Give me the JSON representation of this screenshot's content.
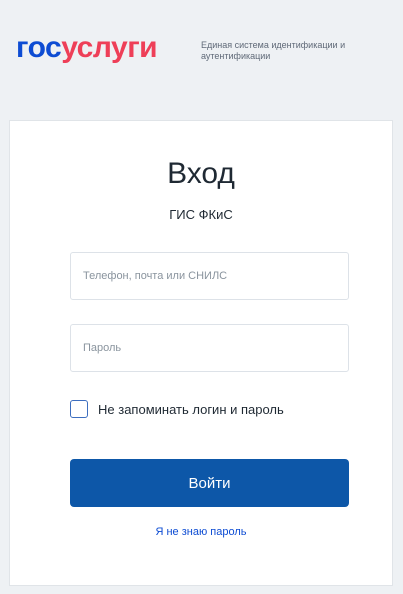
{
  "header": {
    "logo_part_a": "гос",
    "logo_part_b": "услуги",
    "tagline": "Единая система идентификации и аутентификации"
  },
  "login": {
    "title": "Вход",
    "subtitle": "ГИС ФКиС",
    "login_placeholder": "Телефон, почта или СНИЛС",
    "login_value": "",
    "password_placeholder": "Пароль",
    "password_value": "",
    "remember_label": "Не запоминать логин и пароль",
    "remember_checked": false,
    "submit_label": "Войти",
    "forgot_link": "Я не знаю пароль"
  },
  "colors": {
    "brand_blue": "#0d4cd3",
    "brand_red": "#ee3f58",
    "button_blue": "#0d57a8",
    "background": "#eef1f4"
  }
}
